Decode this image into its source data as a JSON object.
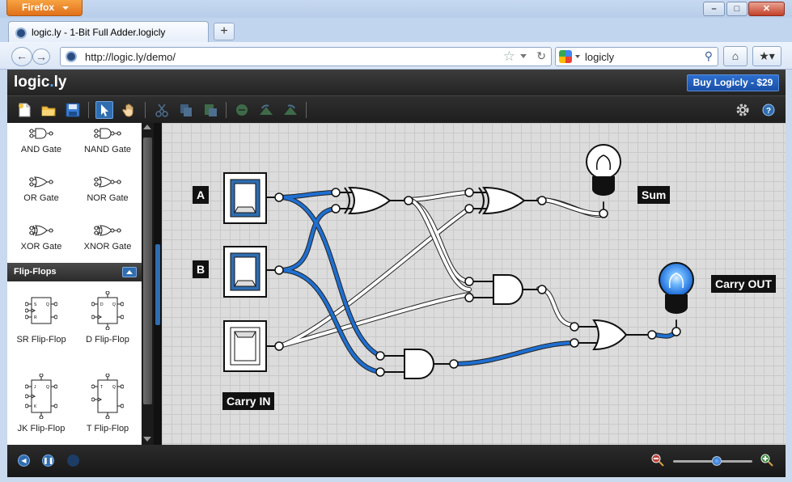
{
  "browser": {
    "menu_button": "Firefox",
    "tab_title": "logic.ly - 1-Bit Full Adder.logicly",
    "new_tab_symbol": "+",
    "url": "http://logic.ly/demo/",
    "search_text": "logicly",
    "window_controls": [
      "minimize",
      "maximize",
      "close"
    ]
  },
  "app": {
    "logo_main": "logic",
    "logo_dot": ".",
    "logo_tail": "ly",
    "buy_button": "Buy Logicly - $29",
    "toolbar_icons": [
      "new-file-icon",
      "open-folder-icon",
      "save-icon",
      "select-arrow-icon",
      "pan-hand-icon",
      "cut-icon",
      "copy-icon",
      "paste-icon",
      "delete-icon",
      "rotate-left-icon",
      "rotate-right-icon",
      "settings-gear-icon",
      "help-icon"
    ],
    "accent_color": "#1f6fd0"
  },
  "sidebar": {
    "gates": [
      {
        "label": "AND Gate"
      },
      {
        "label": "NAND Gate"
      },
      {
        "label": "OR Gate"
      },
      {
        "label": "NOR Gate"
      },
      {
        "label": "XOR Gate"
      },
      {
        "label": "XNOR Gate"
      }
    ],
    "section_title": "Flip-Flops",
    "flipflops": [
      {
        "label": "SR Flip-Flop"
      },
      {
        "label": "D Flip-Flop"
      },
      {
        "label": "JK Flip-Flop"
      },
      {
        "label": "T Flip-Flop"
      }
    ]
  },
  "circuit": {
    "inputs": [
      "A",
      "B",
      "Carry IN"
    ],
    "outputs": [
      "Sum",
      "Carry OUT"
    ],
    "wire_on_color": "#1f6fd0",
    "wire_off_color": "#ffffff",
    "carry_out_lit": true,
    "sum_lit": false
  },
  "footer": {
    "controls": [
      "step-back-icon",
      "pause-icon",
      "record-indicator-icon"
    ],
    "zoom_level": 0.55
  }
}
